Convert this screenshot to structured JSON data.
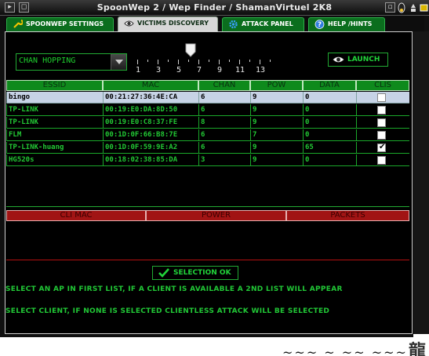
{
  "window": {
    "title": "SpoonWep 2 / Wep Finder / ShamanVirtuel 2K8"
  },
  "tabs": [
    {
      "label": "SPOONWEP SETTINGS",
      "icon": "wrench-icon",
      "active": false
    },
    {
      "label": "VICTIMS DISCOVERY",
      "icon": "eye-icon",
      "active": true
    },
    {
      "label": "ATTACK PANEL",
      "icon": "gear-icon",
      "active": false
    },
    {
      "label": "HELP /HINTS",
      "icon": "question-icon",
      "active": false
    }
  ],
  "controls": {
    "chan_mode": "CHAN HOPPING",
    "channel_ticks": [
      "1",
      "3",
      "5",
      "7",
      "9",
      "11",
      "13"
    ],
    "channel_slider_value": 6,
    "launch_label": "LAUNCH"
  },
  "ap_table": {
    "headers": [
      "ESSID",
      "MAC",
      "CHAN",
      "POW",
      "DATA",
      "CLIS"
    ],
    "rows": [
      {
        "essid": "bingo",
        "mac": "00:21:27:36:4E:CA",
        "chan": "6",
        "pow": "9",
        "data": "0",
        "clis": false,
        "selected": true
      },
      {
        "essid": "TP-LINK",
        "mac": "00:19:E0:DA:8D:50",
        "chan": "6",
        "pow": "9",
        "data": "0",
        "clis": false,
        "selected": false
      },
      {
        "essid": "TP-LINK",
        "mac": "00:19:E0:C8:37:FE",
        "chan": "8",
        "pow": "9",
        "data": "0",
        "clis": false,
        "selected": false
      },
      {
        "essid": "FLM",
        "mac": "00:1D:0F:66:B8:7E",
        "chan": "6",
        "pow": "7",
        "data": "0",
        "clis": false,
        "selected": false
      },
      {
        "essid": "TP-LINK-huang",
        "mac": "00:1D:0F:59:9E:A2",
        "chan": "6",
        "pow": "9",
        "data": "65",
        "clis": true,
        "selected": false
      },
      {
        "essid": "HG520s",
        "mac": "00:18:02:38:85:DA",
        "chan": "3",
        "pow": "9",
        "data": "0",
        "clis": false,
        "selected": false
      }
    ]
  },
  "client_table": {
    "headers": [
      "CLI MAC",
      "POWER",
      "PACKETS"
    ]
  },
  "selection_button": "SELECTION OK",
  "instructions": [
    "SELECT AN AP IN FIRST LIST, IF A CLIENT IS AVAILABLE A 2ND LIST WILL APPEAR",
    "SELECT CLIENT, IF NONE IS SELECTED CLIENTLESS ATTACK WILL BE SELECTED"
  ],
  "colors": {
    "accent_green": "#21c836",
    "header_green": "#0e8a1c",
    "header_red": "#a11414",
    "selected_row": "#c7d3e6"
  }
}
